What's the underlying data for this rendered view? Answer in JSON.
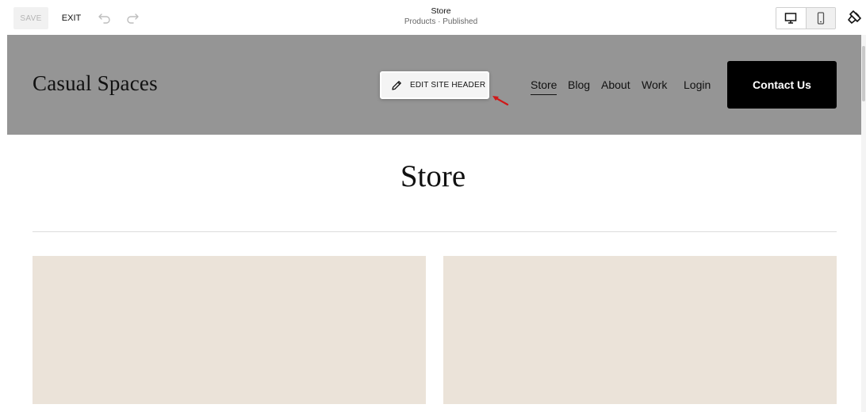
{
  "toolbar": {
    "save_label": "SAVE",
    "exit_label": "EXIT",
    "undo_icon": "undo-icon",
    "redo_icon": "redo-icon",
    "page_title": "Store",
    "page_subtitle": "Products · Published",
    "desktop_icon": "desktop-icon",
    "mobile_icon": "mobile-icon",
    "style_icon": "paintbrush-icon"
  },
  "site_header": {
    "logo_text": "Casual Spaces",
    "edit_button_label": "EDIT SITE HEADER",
    "edit_button_icon": "pencil-icon",
    "nav_items": [
      "Store",
      "Blog",
      "About",
      "Work"
    ],
    "active_nav": "Store",
    "login_label": "Login",
    "cta_label": "Contact Us",
    "background_color": "#959595"
  },
  "page": {
    "title": "Store",
    "product_placeholder_color": "#ebe3d9"
  }
}
